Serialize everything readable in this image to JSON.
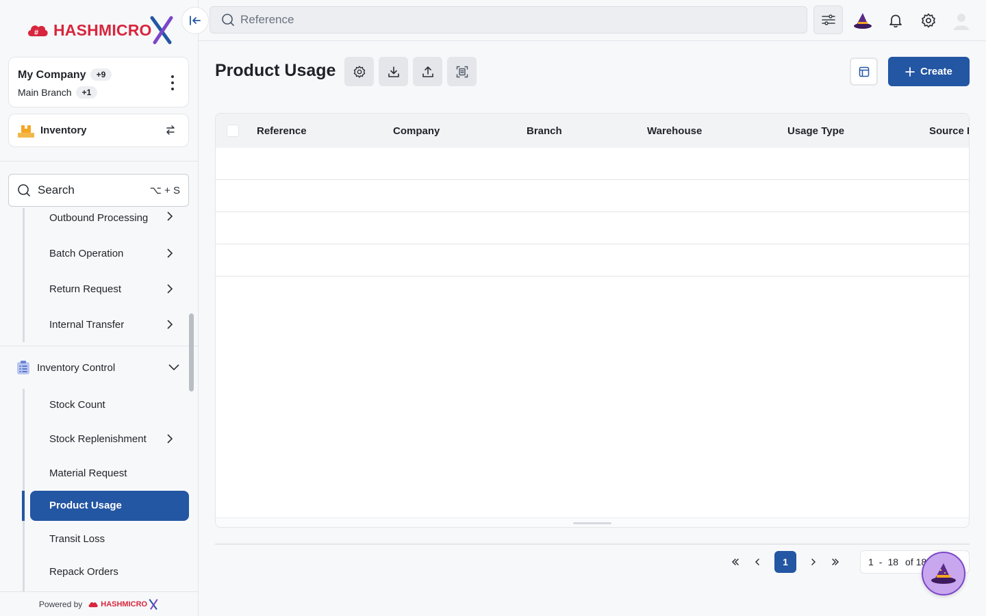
{
  "brand": {
    "name_bold": "HASHMICRO",
    "name_x": "X",
    "accent": "#d7263d",
    "primary": "#2356a3"
  },
  "company": {
    "name": "My Company",
    "company_badge": "+9",
    "branch": "Main Branch",
    "branch_badge": "+1"
  },
  "module": {
    "label": "Inventory"
  },
  "sidebar_search": {
    "placeholder": "Search",
    "shortcut": "⌥ + S"
  },
  "menu": {
    "items_top": [
      {
        "label": "Outbound Processing",
        "has_children": true
      },
      {
        "label": "Batch Operation",
        "has_children": true
      },
      {
        "label": "Return Request",
        "has_children": true
      },
      {
        "label": "Internal Transfer",
        "has_children": true
      }
    ],
    "group": {
      "label": "Inventory Control",
      "expanded": true
    },
    "group_items": [
      {
        "label": "Stock Count",
        "has_children": false
      },
      {
        "label": "Stock Replenishment",
        "has_children": true
      },
      {
        "label": "Material Request",
        "has_children": false
      },
      {
        "label": "Product Usage",
        "has_children": false,
        "active": true
      },
      {
        "label": "Transit Loss",
        "has_children": false
      },
      {
        "label": "Repack Orders",
        "has_children": false
      }
    ]
  },
  "powered_by": {
    "text": "Powered by",
    "brand": "HASHMICRO"
  },
  "topbar": {
    "search_placeholder": "Reference"
  },
  "page": {
    "title": "Product Usage",
    "create_label": "Create"
  },
  "table": {
    "columns": [
      "Reference",
      "Company",
      "Branch",
      "Warehouse",
      "Usage Type",
      "Source D"
    ],
    "rows": [
      [],
      [],
      [],
      []
    ]
  },
  "pagination": {
    "current_page": "1",
    "range_start": "1",
    "range_sep": "-",
    "range_end": "18",
    "total_label": "of 18"
  }
}
